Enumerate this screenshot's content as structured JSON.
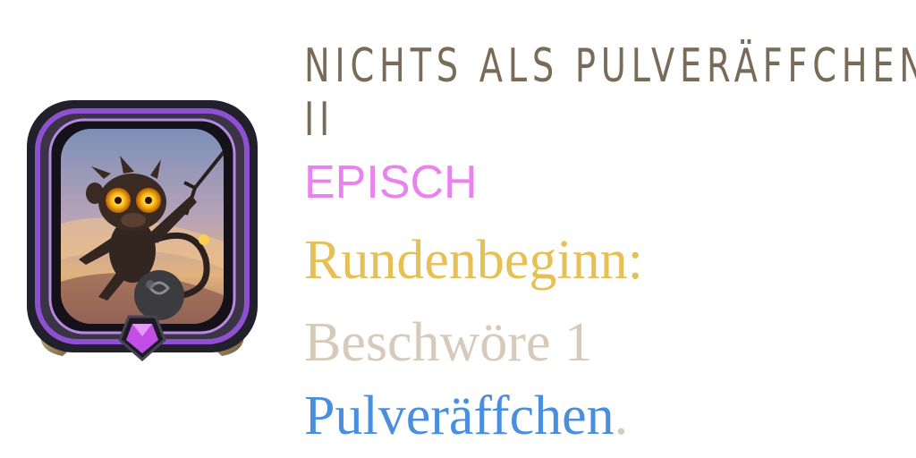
{
  "card": {
    "title_line1": "NICHTS ALS PULVERÄFFCHEN",
    "title_line2": "II",
    "rarity": "EPISCH",
    "rarity_color": "#ea82ee",
    "art_icon": "monkey-with-bomb-portrait",
    "gem_icon": "purple-pentagon-gem",
    "text": {
      "trigger": "Rundenbeginn:",
      "action": "Beschwöre 1",
      "target": "Pulveräffchen",
      "end_punct": "."
    },
    "colors": {
      "title": "#7a6b58",
      "trigger": "#e6bf55",
      "body": "#d7cabb",
      "keyword": "#4a8fde",
      "frame_accent": "#8e4fd0"
    }
  }
}
